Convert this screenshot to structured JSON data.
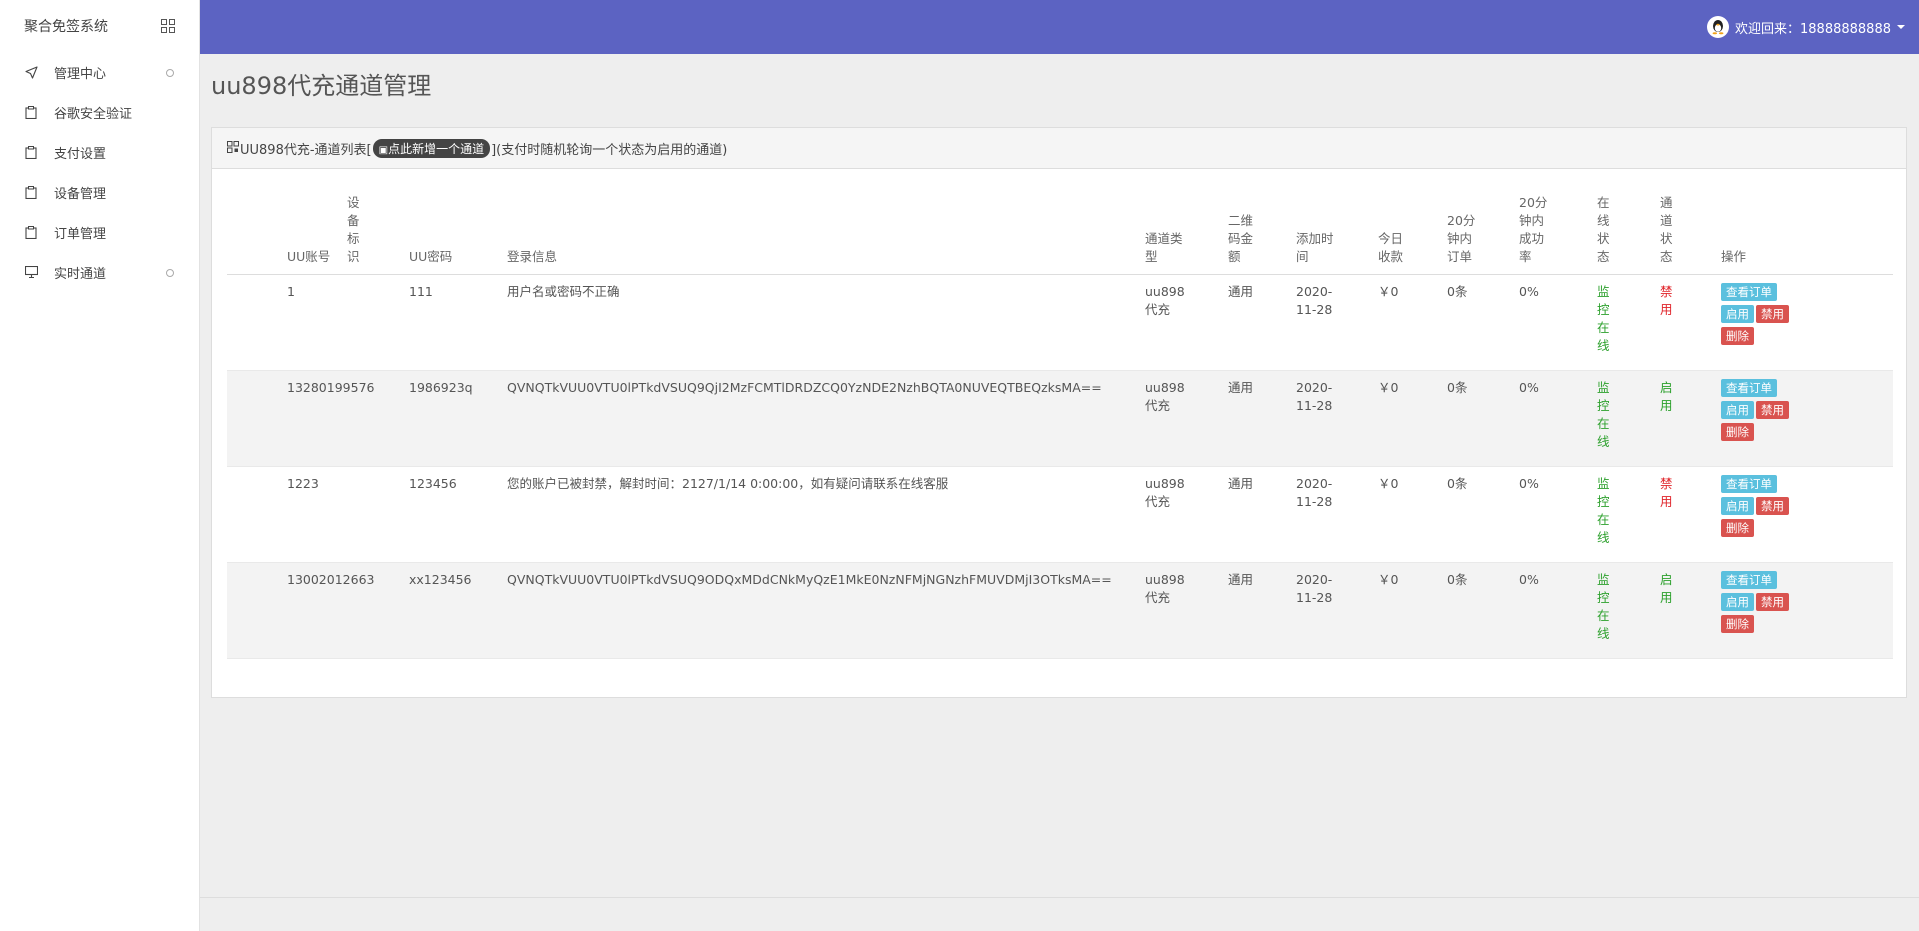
{
  "sidebar": {
    "brand": "聚合免签系统",
    "items": [
      {
        "label": "管理中心",
        "icon": "paper-plane-icon",
        "has_dot": true
      },
      {
        "label": "谷歌安全验证",
        "icon": "clipboard-icon",
        "has_dot": false
      },
      {
        "label": "支付设置",
        "icon": "clipboard-icon",
        "has_dot": false
      },
      {
        "label": "设备管理",
        "icon": "clipboard-icon",
        "has_dot": false
      },
      {
        "label": "订单管理",
        "icon": "clipboard-icon",
        "has_dot": false
      },
      {
        "label": "实时通道",
        "icon": "monitor-icon",
        "has_dot": true
      }
    ]
  },
  "header": {
    "user_greeting": "欢迎回来：18888888888",
    "bar_color": "#5c63c2"
  },
  "main": {
    "title": "uu898代充通道管理",
    "panel": {
      "heading_prefix": "UU898代充-通道列表[",
      "add_button": "点此新增一个通道",
      "heading_suffix": "](支付时随机轮询一个状态为启用的通道)"
    },
    "table": {
      "headers": [
        "UU账号",
        "设备标识",
        "UU密码",
        "登录信息",
        "通道类型",
        "二维码金额",
        "添加时间",
        "今日收款",
        "20分钟内订单",
        "20分钟内成功率",
        "在线状态",
        "通道状态",
        "操作"
      ],
      "rows": [
        {
          "account": "1",
          "device": "",
          "password": "111",
          "login_info": "用户名或密码不正确",
          "type": "uu898代充",
          "amount": "通用",
          "date": "2020-11-28",
          "today": "￥0",
          "orders": "0条",
          "rate": "0%",
          "online": "监控在线",
          "status": "禁用",
          "status_color": "red"
        },
        {
          "account": "13280199576",
          "device": "",
          "password": "1986923q",
          "login_info": "QVNQTkVUU0VTU0lPTkdVSUQ9QjI2MzFCMTlDRDZCQ0YzNDE2NzhBQTA0NUVEQTBEQzksMA==",
          "type": "uu898代充",
          "amount": "通用",
          "date": "2020-11-28",
          "today": "￥0",
          "orders": "0条",
          "rate": "0%",
          "online": "监控在线",
          "status": "启用",
          "status_color": "green"
        },
        {
          "account": "1223",
          "device": "",
          "password": "123456",
          "login_info": "您的账户已被封禁，解封时间：2127/1/14 0:00:00，如有疑问请联系在线客服",
          "type": "uu898代充",
          "amount": "通用",
          "date": "2020-11-28",
          "today": "￥0",
          "orders": "0条",
          "rate": "0%",
          "online": "监控在线",
          "status": "禁用",
          "status_color": "red"
        },
        {
          "account": "13002012663",
          "device": "",
          "password": "xx123456",
          "login_info": "QVNQTkVUU0VTU0lPTkdVSUQ9ODQxMDdCNkMyQzE1MkE0NzNFMjNGNzhFMUVDMjI3OTksMA==",
          "type": "uu898代充",
          "amount": "通用",
          "date": "2020-11-28",
          "today": "￥0",
          "orders": "0条",
          "rate": "0%",
          "online": "监控在线",
          "status": "启用",
          "status_color": "green"
        }
      ],
      "actions": {
        "view": "查看订单",
        "enable": "启用",
        "disable": "禁用",
        "delete": "删除"
      }
    }
  }
}
